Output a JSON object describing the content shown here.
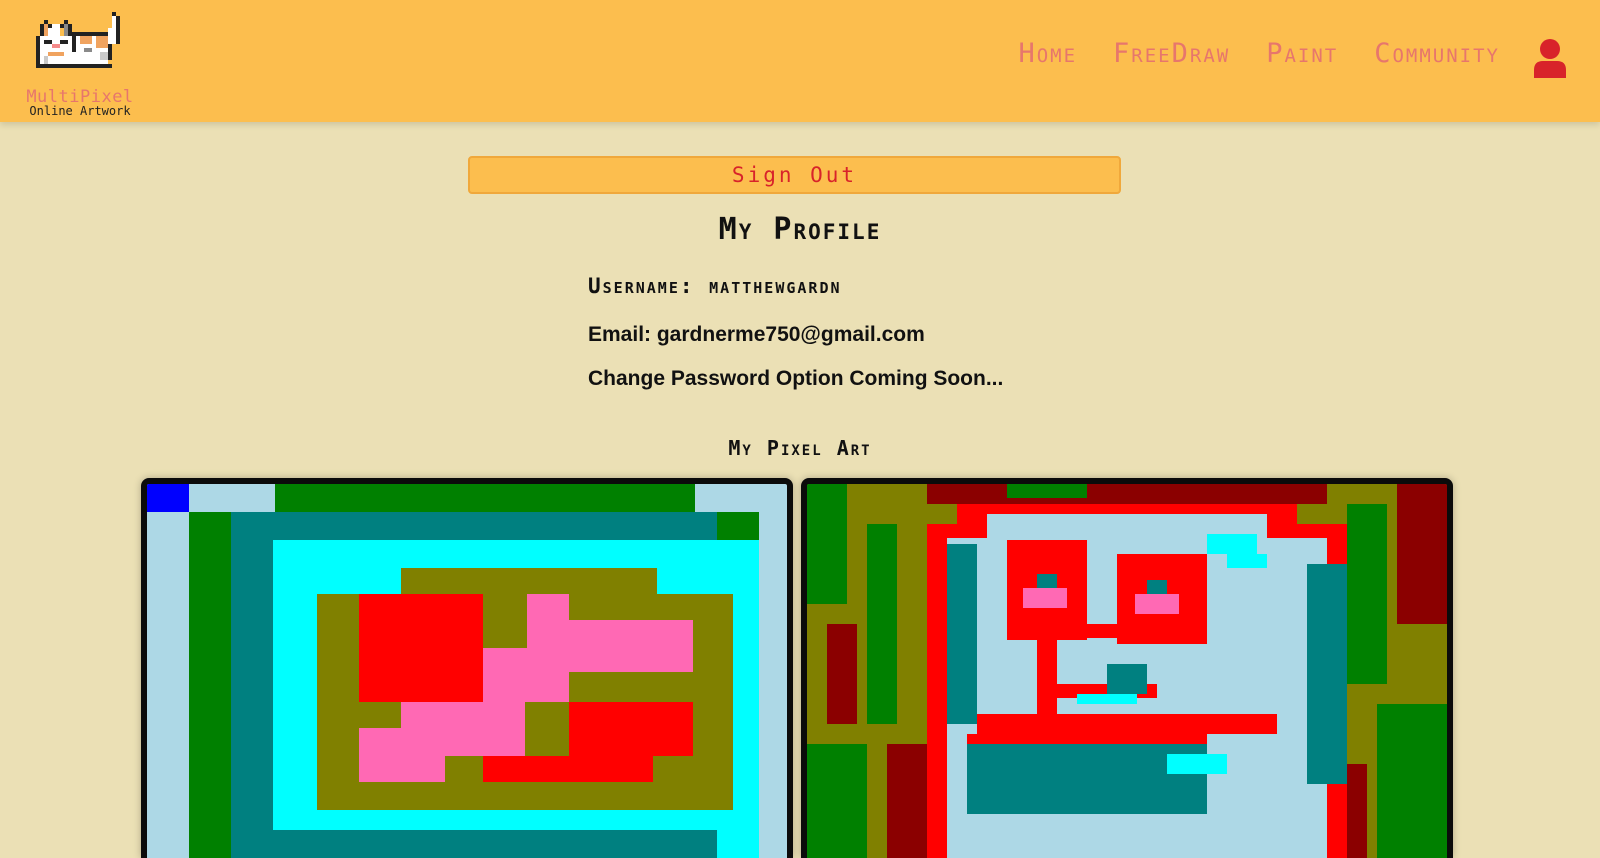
{
  "logo": {
    "title": "MultiPixel",
    "subtitle": "Online Artwork",
    "icon": "pixel-cat-icon"
  },
  "nav": {
    "items": [
      "Home",
      "FreeDraw",
      "Paint",
      "Community"
    ],
    "user_icon": "user-icon"
  },
  "signout_label": "Sign Out",
  "profile": {
    "title": "My Profile",
    "username": "Username: matthewgardn",
    "email": "Email: gardnerme750@gmail.com",
    "password_note": "Change Password Option Coming Soon..."
  },
  "art": {
    "title": "My Pixel Art"
  },
  "colors": {
    "header": "#fcbe4e",
    "background": "#ebe0b5",
    "accent": "#e7766c",
    "signout_text": "#d8232a"
  }
}
